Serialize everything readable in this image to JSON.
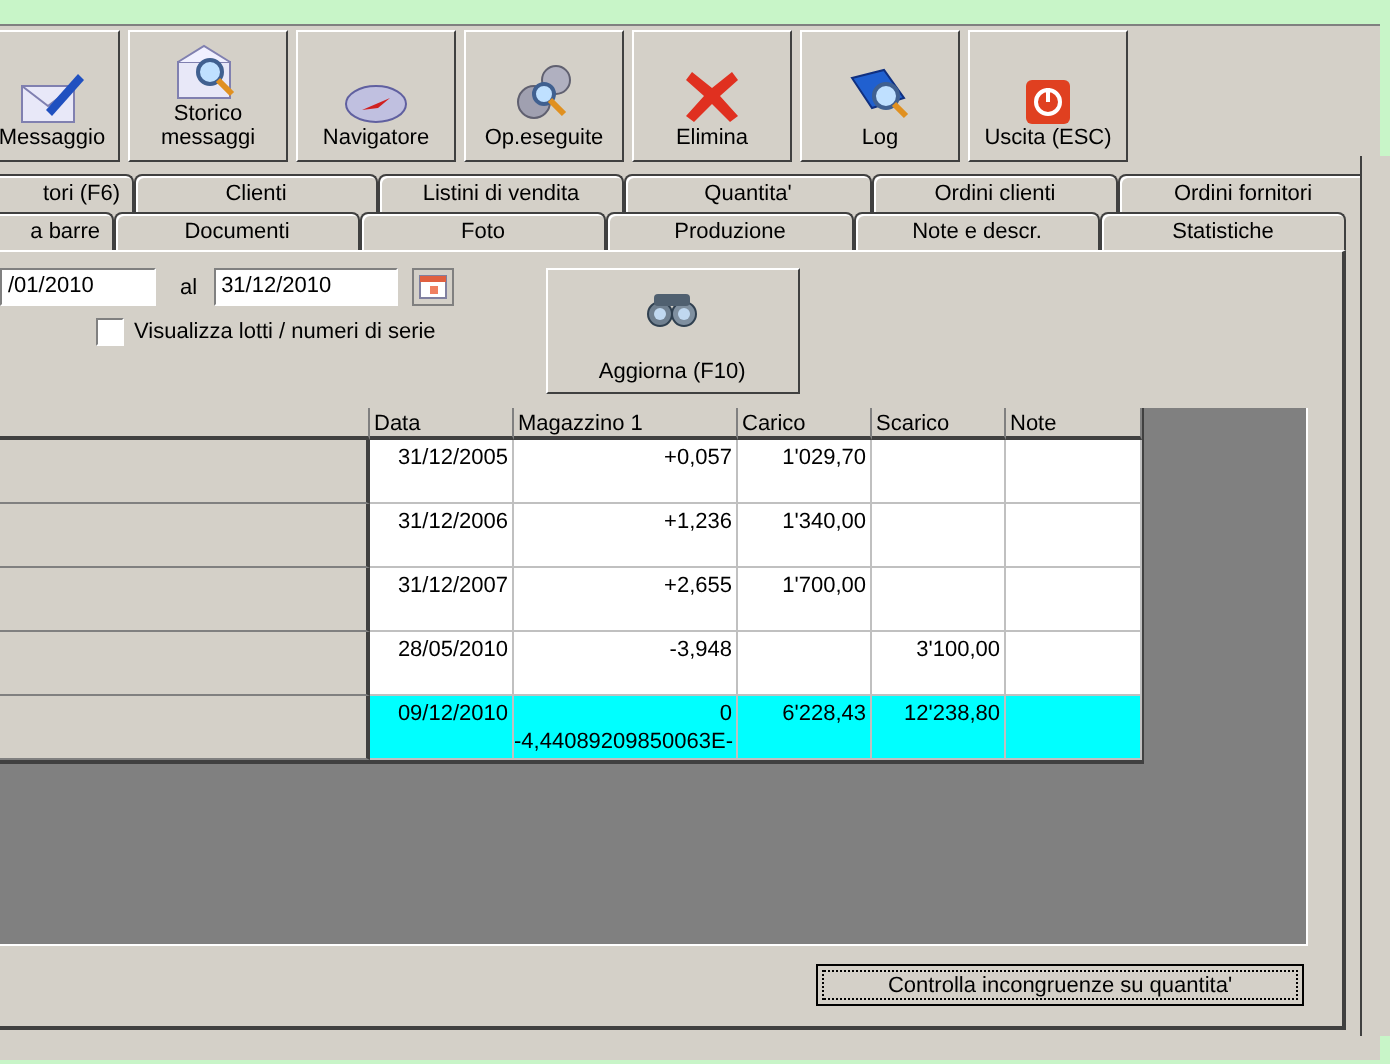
{
  "toolbar": [
    {
      "label": "Messaggio"
    },
    {
      "label": "Storico messaggi"
    },
    {
      "label": "Navigatore"
    },
    {
      "label": "Op.eseguite"
    },
    {
      "label": "Elimina"
    },
    {
      "label": "Log"
    },
    {
      "label": "Uscita (ESC)"
    }
  ],
  "tabs_back": [
    {
      "label": "tori (F6)"
    },
    {
      "label": "Clienti"
    },
    {
      "label": "Listini di vendita"
    },
    {
      "label": "Quantita'"
    },
    {
      "label": "Ordini clienti"
    },
    {
      "label": "Ordini fornitori"
    }
  ],
  "tabs_front": [
    {
      "label": "a barre"
    },
    {
      "label": "Documenti"
    },
    {
      "label": "Foto"
    },
    {
      "label": "Produzione"
    },
    {
      "label": "Note e descr."
    },
    {
      "label": "Statistiche"
    }
  ],
  "filter": {
    "date_from": "/01/2010",
    "to_label": "al",
    "date_to": "31/12/2010",
    "lots_checkbox": {
      "label": "Visualizza lotti /  numeri di serie",
      "checked": false
    },
    "refresh_button": "Aggiorna (F10)"
  },
  "table": {
    "columns": [
      "Data",
      "Magazzino 1",
      "Carico",
      "Scarico",
      "Note"
    ],
    "rows": [
      {
        "selected": false,
        "cells": [
          "31/12/2005",
          "+0,057",
          "1'029,70",
          "",
          ""
        ]
      },
      {
        "selected": false,
        "cells": [
          "31/12/2006",
          "+1,236",
          "1'340,00",
          "",
          ""
        ]
      },
      {
        "selected": false,
        "cells": [
          "31/12/2007",
          "+2,655",
          "1'700,00",
          "",
          ""
        ]
      },
      {
        "selected": false,
        "cells": [
          "28/05/2010",
          "-3,948",
          "",
          "3'100,00",
          ""
        ]
      },
      {
        "selected": true,
        "cells": [
          "09/12/2010",
          "0\n-4,44089209850063E-",
          "6'228,43",
          "12'238,80",
          ""
        ]
      }
    ]
  },
  "check_button": "Controlla incongruenze su quantita'"
}
